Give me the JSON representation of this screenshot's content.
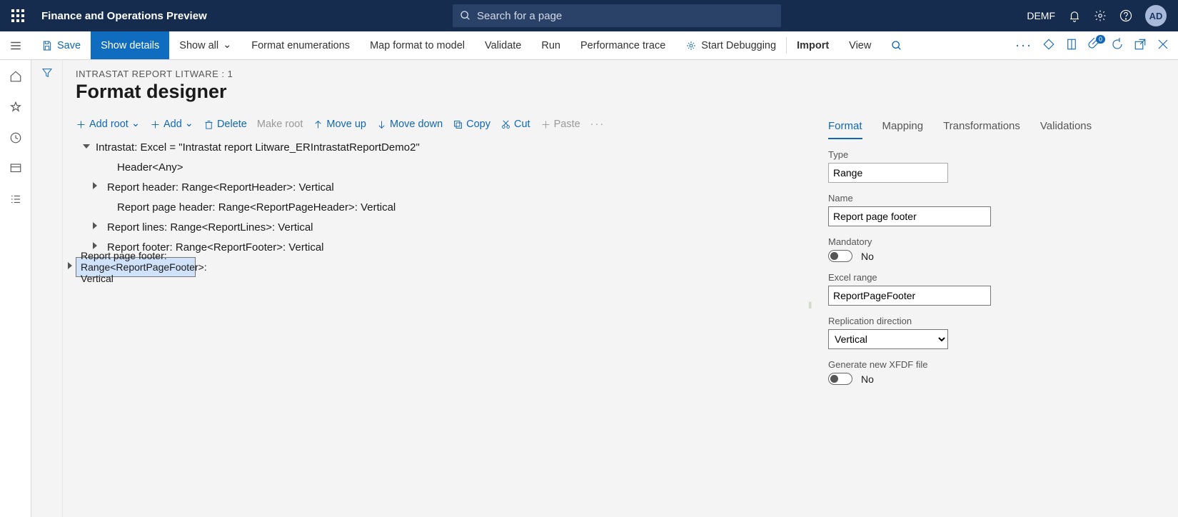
{
  "topbar": {
    "app_title": "Finance and Operations Preview",
    "search_placeholder": "Search for a page",
    "company": "DEMF",
    "avatar": "AD"
  },
  "cmdbar": {
    "save": "Save",
    "show_details": "Show details",
    "show_all": "Show all",
    "format_enum": "Format enumerations",
    "map_format": "Map format to model",
    "validate": "Validate",
    "run": "Run",
    "perf_trace": "Performance trace",
    "start_debug": "Start Debugging",
    "import": "Import",
    "view": "View",
    "badge_count": "0"
  },
  "page": {
    "breadcrumb": "INTRASTAT REPORT LITWARE : 1",
    "title": "Format designer"
  },
  "tree_toolbar": {
    "add_root": "Add root",
    "add": "Add",
    "delete": "Delete",
    "make_root": "Make root",
    "move_up": "Move up",
    "move_down": "Move down",
    "copy": "Copy",
    "cut": "Cut",
    "paste": "Paste"
  },
  "tree": {
    "root": "Intrastat: Excel = \"Intrastat report Litware_ERIntrastatReportDemo2\"",
    "header": "Header<Any>",
    "report_header": "Report header: Range<ReportHeader>: Vertical",
    "report_page_header": "Report page header: Range<ReportPageHeader>: Vertical",
    "report_lines": "Report lines: Range<ReportLines>: Vertical",
    "report_footer": "Report footer: Range<ReportFooter>: Vertical",
    "report_page_footer": "Report page footer: Range<ReportPageFooter>: Vertical"
  },
  "tabs": {
    "format": "Format",
    "mapping": "Mapping",
    "transformations": "Transformations",
    "validations": "Validations"
  },
  "props": {
    "type_label": "Type",
    "type_value": "Range",
    "name_label": "Name",
    "name_value": "Report page footer",
    "mandatory_label": "Mandatory",
    "mandatory_value": "No",
    "excel_label": "Excel range",
    "excel_value": "ReportPageFooter",
    "rep_dir_label": "Replication direction",
    "rep_dir_value": "Vertical",
    "xfdf_label": "Generate new XFDF file",
    "xfdf_value": "No"
  }
}
